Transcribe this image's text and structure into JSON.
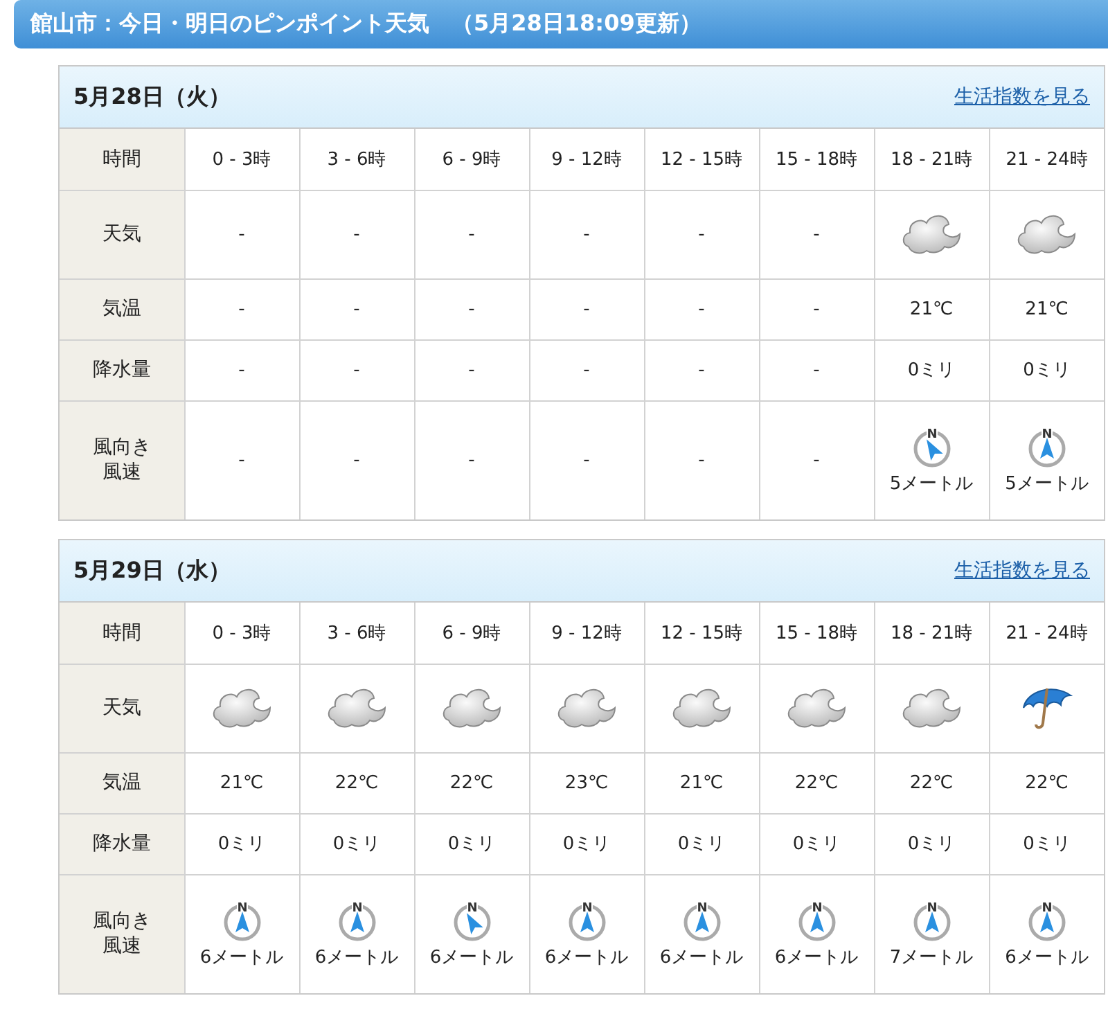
{
  "title": "館山市：今日・明日のピンポイント天気　（5月28日18:09更新）",
  "days": [
    {
      "date": "5月28日（火）",
      "link": "生活指数を見る",
      "time_label": "時間",
      "times": [
        "0 - 3時",
        "3 - 6時",
        "6 - 9時",
        "9 - 12時",
        "12 - 15時",
        "15 - 18時",
        "18 - 21時",
        "21 - 24時"
      ],
      "rows": [
        {
          "kind": "weather",
          "label": "天気",
          "cells": [
            {
              "kind": "dash",
              "text": "-"
            },
            {
              "kind": "dash",
              "text": "-"
            },
            {
              "kind": "dash",
              "text": "-"
            },
            {
              "kind": "dash",
              "text": "-"
            },
            {
              "kind": "dash",
              "text": "-"
            },
            {
              "kind": "dash",
              "text": "-"
            },
            {
              "kind": "cloudy"
            },
            {
              "kind": "cloudy"
            }
          ]
        },
        {
          "kind": "text",
          "label": "気温",
          "cells": [
            "-",
            "-",
            "-",
            "-",
            "-",
            "-",
            "21℃",
            "21℃"
          ]
        },
        {
          "kind": "text",
          "label": "降水量",
          "cells": [
            "-",
            "-",
            "-",
            "-",
            "-",
            "-",
            "0ミリ",
            "0ミリ"
          ]
        },
        {
          "kind": "wind",
          "label_lines": [
            "風向き",
            "風速"
          ],
          "cells": [
            {
              "kind": "dash",
              "text": "-"
            },
            {
              "kind": "dash",
              "text": "-"
            },
            {
              "kind": "dash",
              "text": "-"
            },
            {
              "kind": "dash",
              "text": "-"
            },
            {
              "kind": "dash",
              "text": "-"
            },
            {
              "kind": "dash",
              "text": "-"
            },
            {
              "kind": "northwest",
              "north": "N",
              "speed": "5メートル"
            },
            {
              "kind": "north",
              "north": "N",
              "speed": "5メートル"
            }
          ]
        }
      ]
    },
    {
      "date": "5月29日（水）",
      "link": "生活指数を見る",
      "time_label": "時間",
      "times": [
        "0 - 3時",
        "3 - 6時",
        "6 - 9時",
        "9 - 12時",
        "12 - 15時",
        "15 - 18時",
        "18 - 21時",
        "21 - 24時"
      ],
      "rows": [
        {
          "kind": "weather",
          "label": "天気",
          "cells": [
            {
              "kind": "cloudy"
            },
            {
              "kind": "cloudy"
            },
            {
              "kind": "cloudy"
            },
            {
              "kind": "cloudy"
            },
            {
              "kind": "cloudy"
            },
            {
              "kind": "cloudy"
            },
            {
              "kind": "cloudy"
            },
            {
              "kind": "rain"
            }
          ]
        },
        {
          "kind": "text",
          "label": "気温",
          "cells": [
            "21℃",
            "22℃",
            "22℃",
            "23℃",
            "21℃",
            "22℃",
            "22℃",
            "22℃"
          ]
        },
        {
          "kind": "text",
          "label": "降水量",
          "cells": [
            "0ミリ",
            "0ミリ",
            "0ミリ",
            "0ミリ",
            "0ミリ",
            "0ミリ",
            "0ミリ",
            "0ミリ"
          ]
        },
        {
          "kind": "wind",
          "label_lines": [
            "風向き",
            "風速"
          ],
          "cells": [
            {
              "kind": "north",
              "north": "N",
              "speed": "6メートル"
            },
            {
              "kind": "north",
              "north": "N",
              "speed": "6メートル"
            },
            {
              "kind": "northwest",
              "north": "N",
              "speed": "6メートル"
            },
            {
              "kind": "north",
              "north": "N",
              "speed": "6メートル"
            },
            {
              "kind": "north",
              "north": "N",
              "speed": "6メートル"
            },
            {
              "kind": "north",
              "north": "N",
              "speed": "6メートル"
            },
            {
              "kind": "north",
              "north": "N",
              "speed": "7メートル"
            },
            {
              "kind": "north",
              "north": "N",
              "speed": "6メートル"
            }
          ]
        }
      ]
    }
  ]
}
